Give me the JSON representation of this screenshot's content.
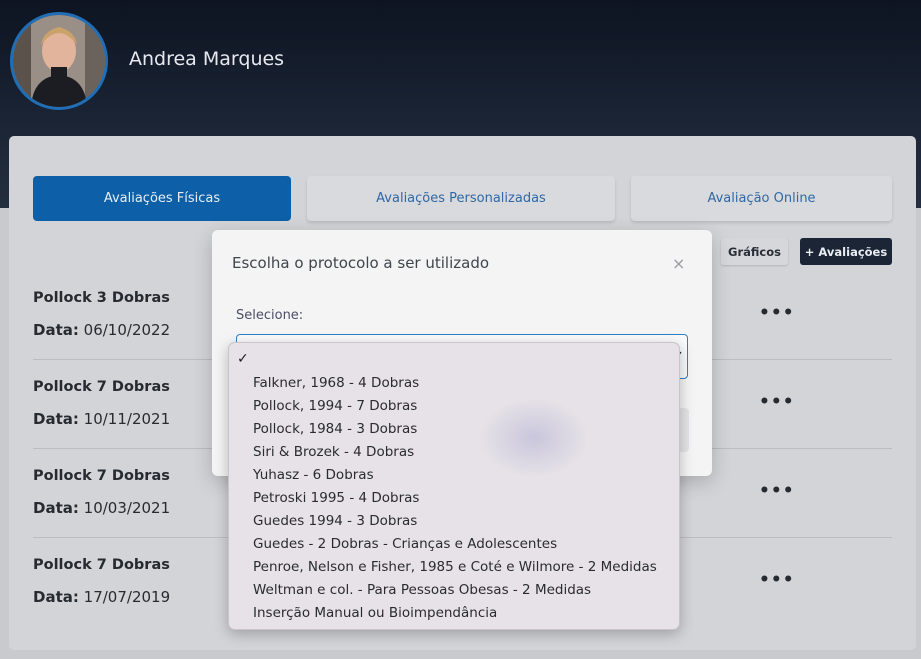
{
  "user": {
    "name": "Andrea Marques"
  },
  "tabs": [
    {
      "label": "Avaliações Físicas",
      "active": true
    },
    {
      "label": "Avaliações Personalizadas",
      "active": false
    },
    {
      "label": "Avaliação Online",
      "active": false
    }
  ],
  "actions": {
    "graficos": "Gráficos",
    "add_avaliacoes": "+ Avaliações"
  },
  "evaluations": [
    {
      "title": "Pollock 3 Dobras",
      "date_label": "Data:",
      "date": "06/10/2022"
    },
    {
      "title": "Pollock 7 Dobras",
      "date_label": "Data:",
      "date": "10/11/2021"
    },
    {
      "title": "Pollock 7 Dobras",
      "date_label": "Data:",
      "date": "10/03/2021"
    },
    {
      "title": "Pollock 7 Dobras",
      "date_label": "Data:",
      "date": "17/07/2019"
    }
  ],
  "row_menu_glyph": "•••",
  "modal": {
    "title": "Escolha o protocolo a ser utilizado",
    "close_glyph": "×",
    "select_label": "Selecione:",
    "selected_value": "",
    "check_glyph": "✓",
    "options": [
      "Falkner, 1968 - 4 Dobras",
      "Pollock, 1994 - 7 Dobras",
      "Pollock, 1984 - 3 Dobras",
      "Siri & Brozek - 4 Dobras",
      "Yuhasz - 6 Dobras",
      "Petroski 1995 - 4 Dobras",
      "Guedes 1994 - 3 Dobras",
      "Guedes - 2 Dobras - Crianças e Adolescentes",
      "Penroe, Nelson e Fisher, 1985 e Coté e Wilmore - 2 Medidas",
      "Weltman e col. - Para Pessoas Obesas - 2 Medidas",
      "Inserção Manual ou Bioimpendância"
    ]
  },
  "colors": {
    "header_bg": "#1b2535",
    "primary": "#0d60a7",
    "link_blue": "#2f68a5",
    "dark_button": "#1b2536"
  }
}
